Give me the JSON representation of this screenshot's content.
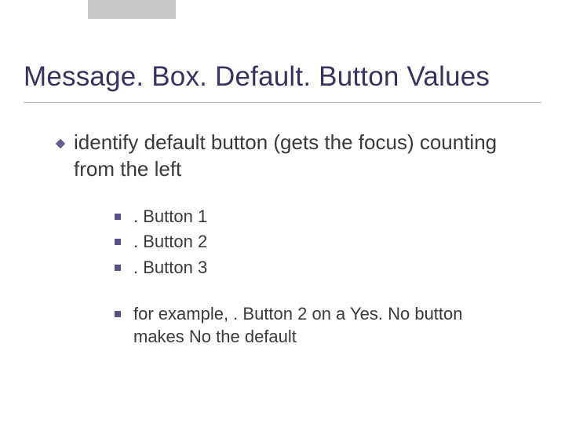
{
  "title": "Message. Box. Default. Button Values",
  "body": {
    "main_point": "identify default button (gets the focus) counting from the left",
    "items": [
      ". Button 1",
      ". Button 2",
      ". Button 3"
    ],
    "example": "for example, . Button 2 on a Yes. No button makes No the default"
  },
  "colors": {
    "title": "#3a3160",
    "bullet_diamond": "#5a4f84",
    "bullet_square": "#5a4f84"
  }
}
